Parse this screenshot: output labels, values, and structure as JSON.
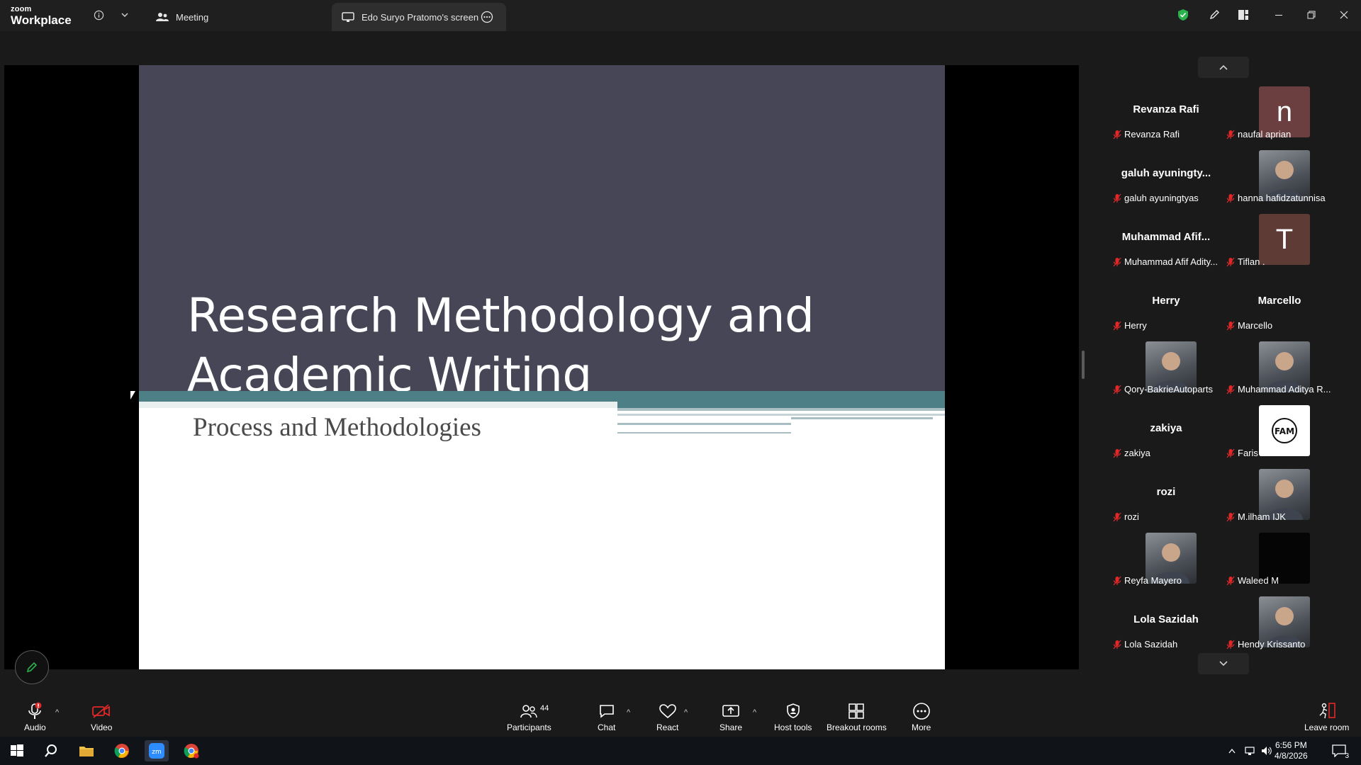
{
  "app": {
    "brand_small": "zoom",
    "brand_big": "Workplace"
  },
  "tabs": [
    {
      "label": "Meeting"
    },
    {
      "label": "Edo Suryo Pratomo's screen"
    }
  ],
  "slide": {
    "title_line1": "Research Methodology and",
    "title_line2": "Academic Writing",
    "subtitle": "Process and Methodologies"
  },
  "participants": [
    {
      "name": "Revanza Rafi",
      "label": "Revanza Rafi",
      "avatar": "none"
    },
    {
      "name": "naufal aprian",
      "label": "naufal aprian",
      "avatar": "letter",
      "letter": "n",
      "color": "#6b3f3f"
    },
    {
      "name": "galuh ayuningty...",
      "label": "galuh ayuningtyas",
      "avatar": "none"
    },
    {
      "name": "hanna hafidzatunnisa",
      "label": "hanna hafidzatunnisa",
      "avatar": "photo"
    },
    {
      "name": "Muhammad Afif...",
      "label": "Muhammad Afif Adity...",
      "avatar": "none"
    },
    {
      "name": "Tiflan .",
      "label": "Tiflan .",
      "avatar": "letter",
      "letter": "T",
      "color": "#5e3b35"
    },
    {
      "name": "Herry",
      "label": "Herry",
      "avatar": "none"
    },
    {
      "name": "Marcello",
      "label": "Marcello",
      "avatar": "none"
    },
    {
      "name": "Qory-BakrieAutoparts",
      "label": "Qory-BakrieAutoparts",
      "avatar": "photo"
    },
    {
      "name": "Muhammad Aditya R...",
      "label": "Muhammad Aditya R...",
      "avatar": "photo"
    },
    {
      "name": "zakiya",
      "label": "zakiya",
      "avatar": "none"
    },
    {
      "name": "Faris Alhaadi",
      "label": "Faris Alhaadi",
      "avatar": "logo",
      "logo_text": "FAM"
    },
    {
      "name": "rozi",
      "label": "rozi",
      "avatar": "none"
    },
    {
      "name": "M.ilham IJK",
      "label": "M.ilham IJK",
      "avatar": "photo"
    },
    {
      "name": "Reyfa Mayero",
      "label": "Reyfa Mayero",
      "avatar": "photo"
    },
    {
      "name": "Waleed M",
      "label": "Waleed M",
      "avatar": "dark"
    },
    {
      "name": "Lola Sazidah",
      "label": "Lola Sazidah",
      "avatar": "none"
    },
    {
      "name": "Hendy Krissanto",
      "label": "Hendy Krissanto",
      "avatar": "photo"
    }
  ],
  "toolbar": {
    "audio": "Audio",
    "video": "Video",
    "participants": "Participants",
    "participants_count": "44",
    "chat": "Chat",
    "react": "React",
    "share": "Share",
    "host_tools": "Host tools",
    "breakout_rooms": "Breakout rooms",
    "more": "More",
    "leave": "Leave room"
  },
  "taskbar": {
    "time": "6:56 PM",
    "date": "4/8/2026",
    "notifications": "3"
  },
  "colors": {
    "muted_red": "#e02828",
    "security_green": "#2bb24c",
    "slide_dark": "#464656",
    "slide_teal": "#4d7f86"
  }
}
